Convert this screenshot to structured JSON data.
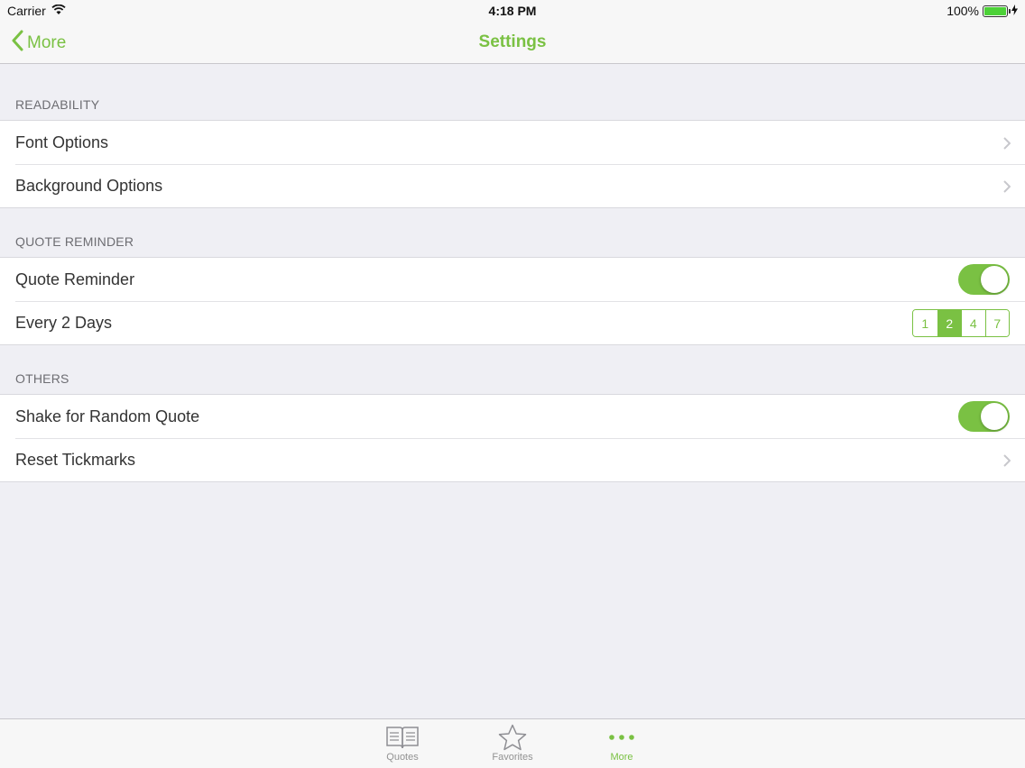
{
  "status_bar": {
    "carrier": "Carrier",
    "time": "4:18 PM",
    "battery": "100%"
  },
  "nav": {
    "back_label": "More",
    "title": "Settings"
  },
  "sections": {
    "readability": {
      "header": "READABILITY",
      "items": [
        "Font Options",
        "Background Options"
      ]
    },
    "quote_reminder": {
      "header": "QUOTE REMINDER",
      "toggle_label": "Quote Reminder",
      "toggle_on": true,
      "frequency_label": "Every 2 Days",
      "segments": [
        "1",
        "2",
        "4",
        "7"
      ],
      "selected_segment": "2"
    },
    "others": {
      "header": "OTHERS",
      "shake_label": "Shake for Random Quote",
      "shake_on": true,
      "reset_label": "Reset Tickmarks"
    }
  },
  "tab_bar": {
    "tabs": [
      {
        "label": "Quotes",
        "icon": "book-icon"
      },
      {
        "label": "Favorites",
        "icon": "star-icon"
      },
      {
        "label": "More",
        "icon": "more-dots-icon",
        "active": true
      }
    ]
  },
  "colors": {
    "accent": "#7ac143",
    "background": "#efeff4"
  }
}
